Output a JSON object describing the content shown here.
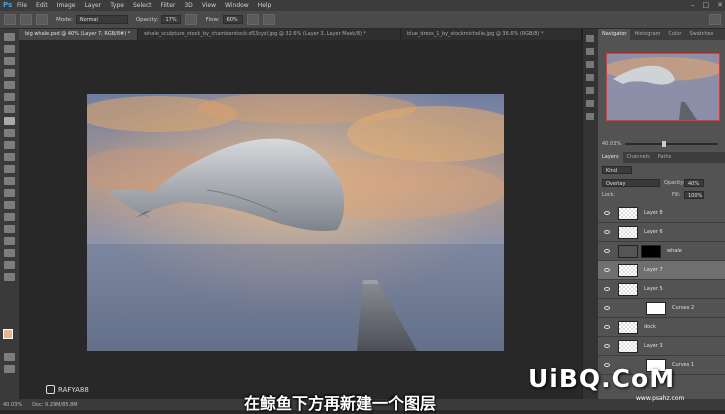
{
  "app": {
    "logo": "Ps",
    "menu": [
      "File",
      "Edit",
      "Image",
      "Layer",
      "Type",
      "Select",
      "Filter",
      "3D",
      "View",
      "Window",
      "Help"
    ],
    "window_controls": [
      "–",
      "□",
      "✕"
    ]
  },
  "options": {
    "mode_label": "Mode:",
    "mode_value": "Normal",
    "opacity_label": "Opacity:",
    "opacity_value": "17%",
    "flow_label": "Flow:",
    "flow_value": "60%"
  },
  "tabs": [
    "big whale.psd @ 40% (Layer 7, RGB/8#) *",
    "whale_sculpture_stock_by_chamberstock-d53cyzl.jpg @ 32.6% (Layer 3, Layer Mask/8) *",
    "blue_dress_1_by_stockmichelle.jpg @ 36.6% (RGB/8) *"
  ],
  "status": {
    "zoom": "40.03%",
    "doc": "Doc: 9.29M/85.8M"
  },
  "navigator": {
    "tabs": [
      "Navigator",
      "Histogram",
      "Color",
      "Swatches"
    ],
    "zoom": "40.03%"
  },
  "layers_panel": {
    "tabs": [
      "Layers",
      "Channels",
      "Paths"
    ],
    "filter": "Kind",
    "blend_mode": "Overlay",
    "opacity_label": "Opacity:",
    "opacity_value": "40%",
    "lock_label": "Lock:",
    "fill_label": "Fill:",
    "fill_value": "100%",
    "layers": [
      {
        "name": "Layer 8"
      },
      {
        "name": "Layer 6"
      },
      {
        "name": "whale"
      },
      {
        "name": "Layer 7"
      },
      {
        "name": "Layer 5"
      },
      {
        "name": "Curves 2"
      },
      {
        "name": "dock"
      },
      {
        "name": "Layer 3"
      },
      {
        "name": "Curves 1"
      }
    ]
  },
  "overlay": {
    "author": "RAFYA88",
    "subtitle": "在鲸鱼下方再新建一个图层",
    "brand": "UiBQ.CoM",
    "brand_sub": "www.psahz.com"
  },
  "colors": {
    "accent": "#31a8ff",
    "foreground": "#e3b98a",
    "background": "#ffffff"
  }
}
